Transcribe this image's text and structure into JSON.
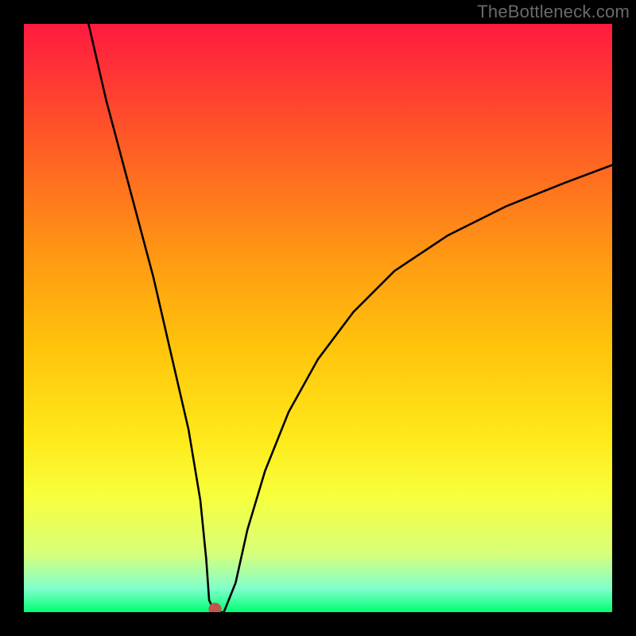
{
  "watermark": "TheBottleneck.com",
  "chart_data": {
    "type": "line",
    "title": "",
    "xlabel": "",
    "ylabel": "",
    "xlim": [
      0,
      100
    ],
    "ylim": [
      0,
      100
    ],
    "x": [
      11,
      14,
      18,
      22,
      25,
      28,
      30,
      31,
      31.5,
      32.5,
      34,
      36,
      38,
      41,
      45,
      50,
      56,
      63,
      72,
      82,
      92,
      100
    ],
    "y": [
      100,
      87,
      72,
      57,
      44,
      31,
      19,
      9,
      2,
      0,
      0,
      5,
      14,
      24,
      34,
      43,
      51,
      58,
      64,
      69,
      73,
      76
    ],
    "marker": {
      "x": 32.5,
      "y": 0.5,
      "color": "#c2544f"
    }
  }
}
